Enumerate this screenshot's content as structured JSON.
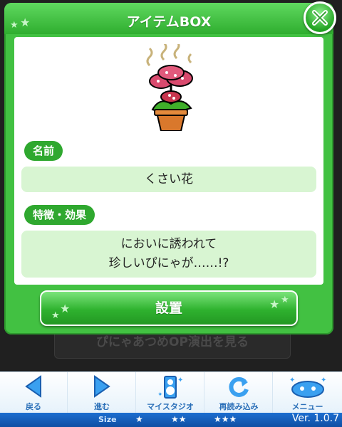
{
  "dialog": {
    "title": "アイテムBOX",
    "name_label": "名前",
    "name_value": "くさい花",
    "feature_label": "特徴・効果",
    "feature_line1": "においに誘われて",
    "feature_line2": "珍しいぴにゃが……!?",
    "confirm_label": "設置"
  },
  "background": {
    "button_label": "ぴにゃあつめOP演出を見る"
  },
  "nav": [
    {
      "label": "戻る",
      "icon": "back-arrow-icon"
    },
    {
      "label": "進む",
      "icon": "forward-arrow-icon"
    },
    {
      "label": "マイスタジオ",
      "icon": "speaker-icon"
    },
    {
      "label": "再読み込み",
      "icon": "reload-icon"
    },
    {
      "label": "メニュー",
      "icon": "menu-icon"
    }
  ],
  "status": {
    "size_label": "Size",
    "size_options": [
      "★",
      "★★",
      "★★★"
    ],
    "version": "Ver. 1.0.7"
  },
  "colors": {
    "accent_green": "#42c142",
    "nav_blue": "#2a6fb8"
  }
}
